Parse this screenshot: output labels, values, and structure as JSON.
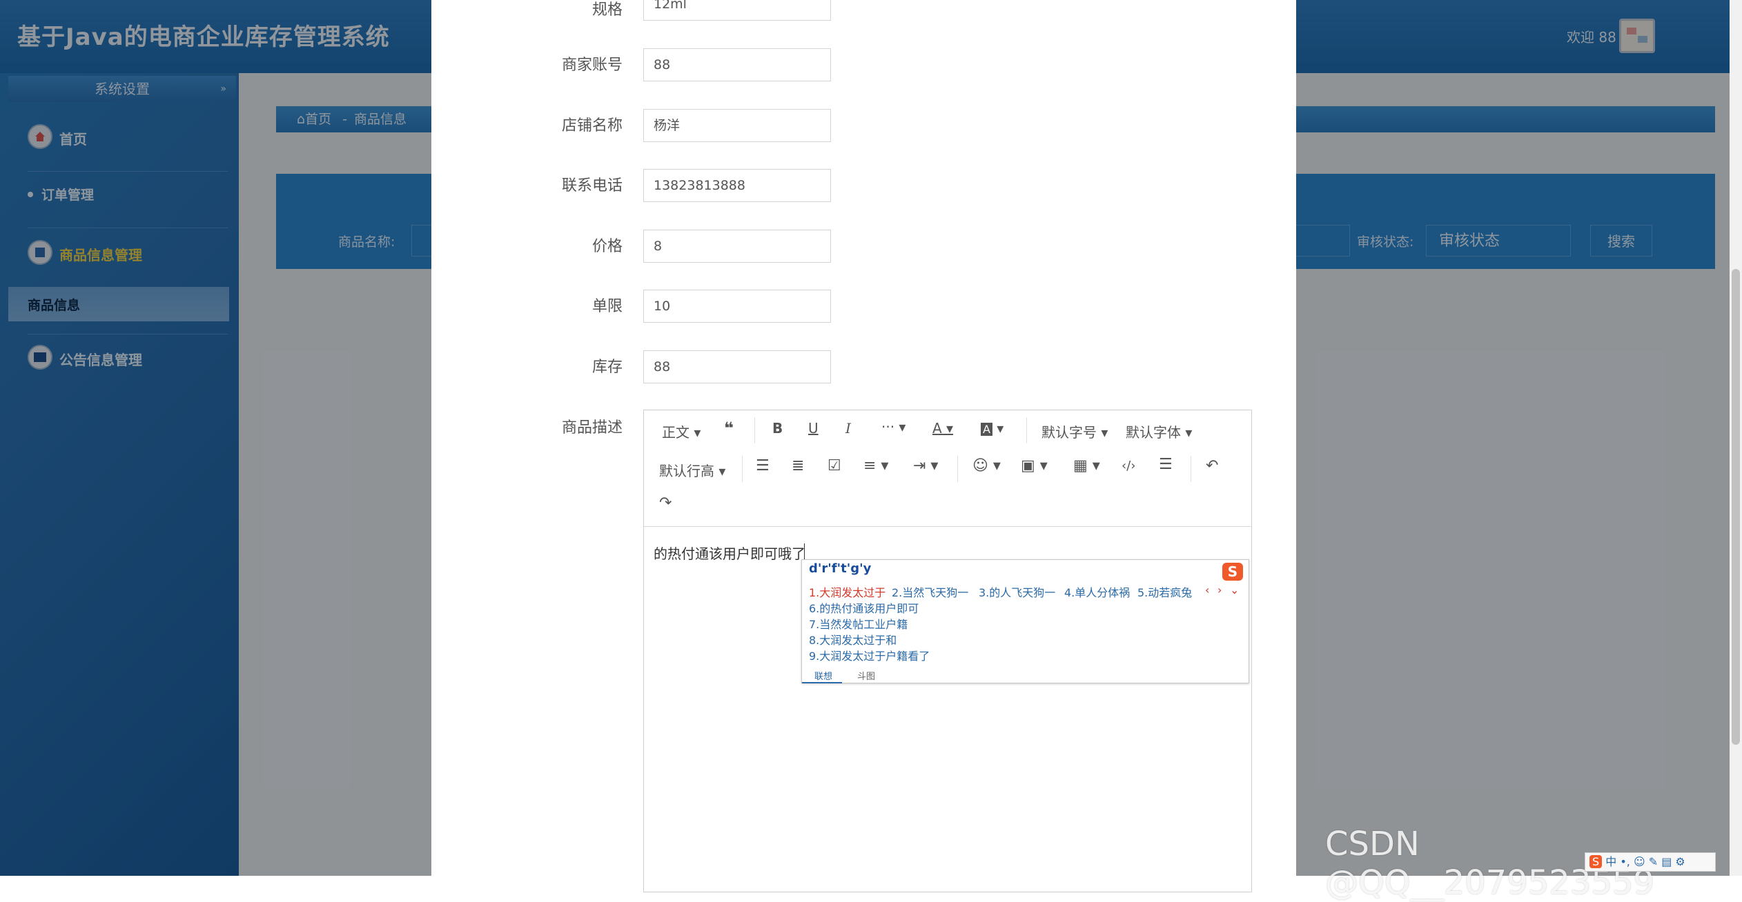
{
  "header": {
    "title": "基于Java的电商企业库存管理系统",
    "welcome": "欢迎 88",
    "avatar_icon": "avatar-image"
  },
  "sidebar": {
    "section_title": "系统设置",
    "items": [
      {
        "label": "首页",
        "icon": "home-icon"
      },
      {
        "label": "订单管理",
        "icon": "bullet-icon"
      },
      {
        "label": "商品信息管理",
        "icon": "box-icon"
      },
      {
        "label": "商品信息",
        "icon": ""
      },
      {
        "label": "公告信息管理",
        "icon": "notice-icon"
      }
    ]
  },
  "breadcrumb": {
    "home": "首页",
    "current": "商品信息"
  },
  "search": {
    "name_label": "商品名称:",
    "audit_label": "审核状态:",
    "audit_value": "审核状态",
    "button": "搜索"
  },
  "form": {
    "fields": [
      {
        "label": "规格",
        "value": "12ml"
      },
      {
        "label": "商家账号",
        "value": "88"
      },
      {
        "label": "店铺名称",
        "value": "杨洋"
      },
      {
        "label": "联系电话",
        "value": "13823813888"
      },
      {
        "label": "价格",
        "value": "8"
      },
      {
        "label": "单限",
        "value": "10"
      },
      {
        "label": "库存",
        "value": "88"
      }
    ],
    "description_label": "商品描述"
  },
  "editor": {
    "toolbar": {
      "paragraph": "正文",
      "font_size": "默认字号",
      "font_family": "默认字体",
      "line_height": "默认行高"
    },
    "content": "的热付通该用户即可哦了"
  },
  "ime": {
    "pinyin": "d'r'f't'g'y",
    "candidates": [
      "1.大润发太过于",
      "2.当然飞天狗一",
      "3.的人飞天狗一",
      "4.单人分体祸",
      "5.动若疯兔",
      "6.的热付通该用户即可",
      "7.当然发帖工业户籍",
      "8.大润发太过于和",
      "9.大润发太过于户籍看了"
    ],
    "tabs": [
      "联想",
      "斗图"
    ]
  },
  "watermark": "CSDN @QQ__2079523559"
}
